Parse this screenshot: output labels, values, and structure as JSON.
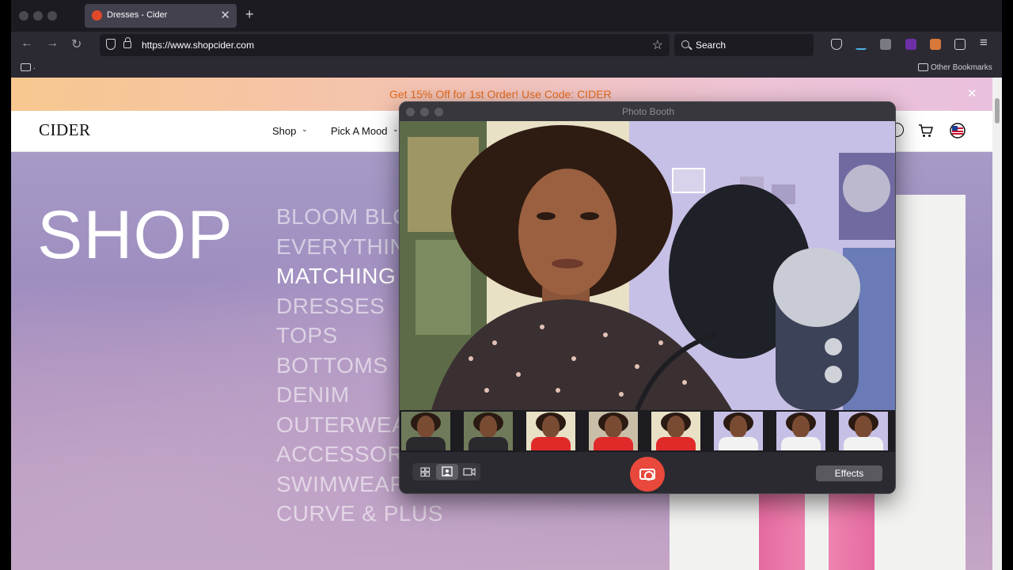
{
  "browser": {
    "tab_title": "Dresses - Cider",
    "tab_close": "✕",
    "new_tab": "+",
    "back": "←",
    "forward": "→",
    "reload": "↻",
    "url": "https://www.shopcider.com",
    "star": "☆",
    "search_placeholder": "Search",
    "bookmarks_dot": ".",
    "other_bookmarks": "Other Bookmarks",
    "menu": "≡"
  },
  "site": {
    "promo_text": "Get 15% Off for 1st Order! Use Code: CIDER",
    "promo_close": "✕",
    "logo": "CIDER",
    "nav": [
      {
        "label": "Shop"
      },
      {
        "label": "Pick A Mood"
      }
    ],
    "chevron": "⌄",
    "hero_title": "SHOP",
    "categories": [
      "BLOOM BLO",
      "EVERYTHING",
      "MATCHING",
      "DRESSES",
      "TOPS",
      "BOTTOMS",
      "DENIM",
      "OUTERWEAR",
      "ACCESSORI",
      "SWIMWEAR",
      "CURVE & PLUS"
    ],
    "active_category": "MATCHING"
  },
  "photobooth": {
    "title": "Photo Booth",
    "effects_label": "Effects",
    "thumbnail_count": 8
  },
  "colors": {
    "accent_orange": "#e46a1c",
    "shutter_red": "#e8493c"
  }
}
